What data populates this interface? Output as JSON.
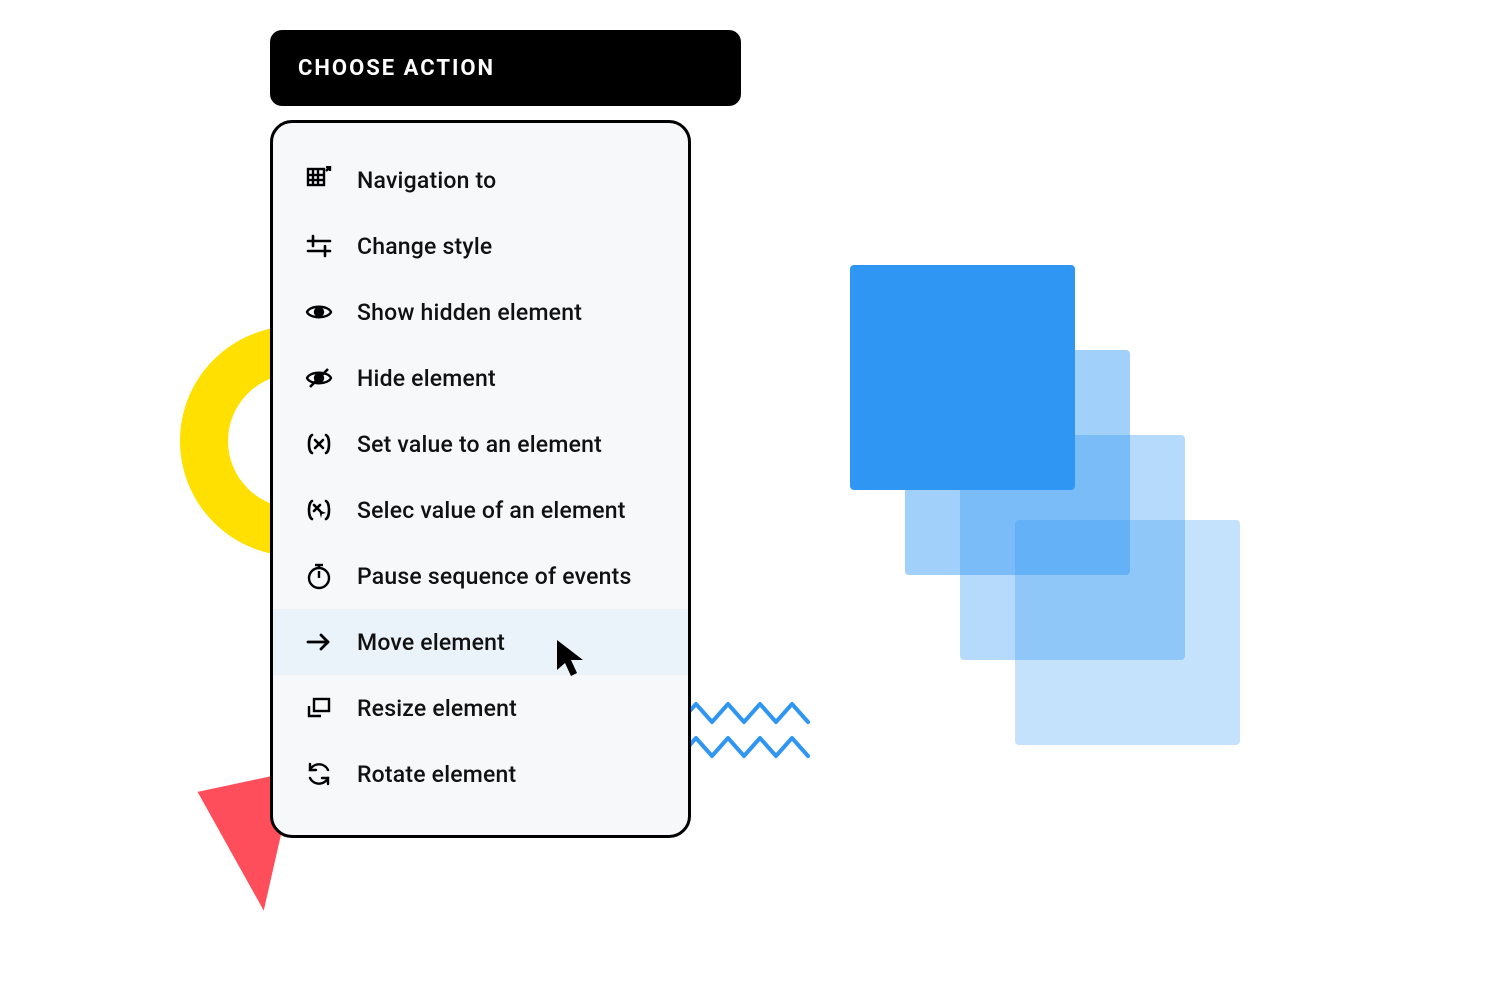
{
  "header": {
    "title": "CHOOSE ACTION"
  },
  "menu": {
    "items": [
      {
        "icon": "grid-nav-icon",
        "label": "Navigation to"
      },
      {
        "icon": "sliders-icon",
        "label": "Change style"
      },
      {
        "icon": "eye-icon",
        "label": "Show hidden element"
      },
      {
        "icon": "eye-off-icon",
        "label": "Hide element"
      },
      {
        "icon": "set-value-icon",
        "label": "Set value to an element"
      },
      {
        "icon": "select-value-icon",
        "label": "Selec value of an element"
      },
      {
        "icon": "stopwatch-icon",
        "label": "Pause sequence of events"
      },
      {
        "icon": "arrow-right-icon",
        "label": "Move element",
        "highlighted": true
      },
      {
        "icon": "resize-icon",
        "label": "Resize element"
      },
      {
        "icon": "rotate-icon",
        "label": "Rotate element"
      }
    ]
  },
  "colors": {
    "accent_yellow": "#ffe000",
    "accent_red": "#ff4e5b",
    "accent_blue": "#2f96f3",
    "panel_bg": "#f6f8fa",
    "highlight_bg": "#eaf2fa"
  }
}
